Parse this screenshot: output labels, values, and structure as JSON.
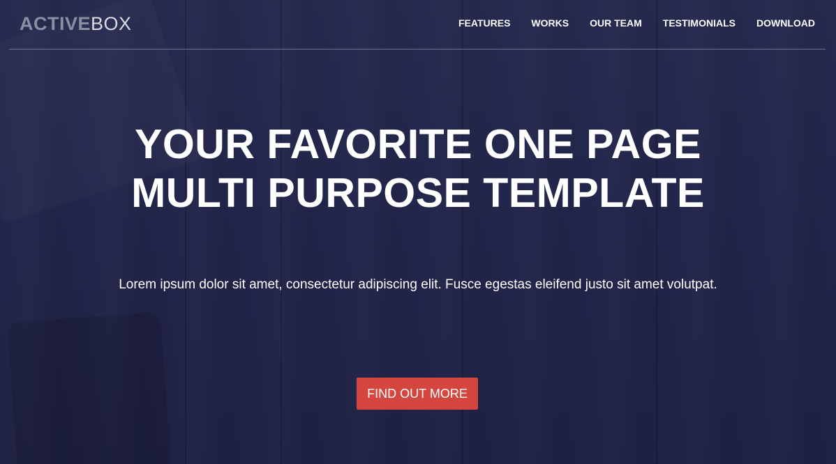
{
  "brand": {
    "bold": "ACTIVE",
    "light": "BOX"
  },
  "nav": {
    "items": [
      {
        "label": "FEATURES"
      },
      {
        "label": "WORKS"
      },
      {
        "label": "OUR TEAM"
      },
      {
        "label": "TESTIMONIALS"
      },
      {
        "label": "DOWNLOAD"
      }
    ]
  },
  "hero": {
    "headline_line1": "YOUR FAVORITE ONE PAGE",
    "headline_line2": "MULTI PURPOSE TEMPLATE",
    "subtext": "Lorem ipsum dolor sit amet, consectetur adipiscing elit. Fusce egestas eleifend justo sit amet volutpat.",
    "cta_label": "FIND OUT MORE"
  },
  "colors": {
    "background": "#23264a",
    "accent": "#d5463f",
    "text": "#ffffff"
  }
}
